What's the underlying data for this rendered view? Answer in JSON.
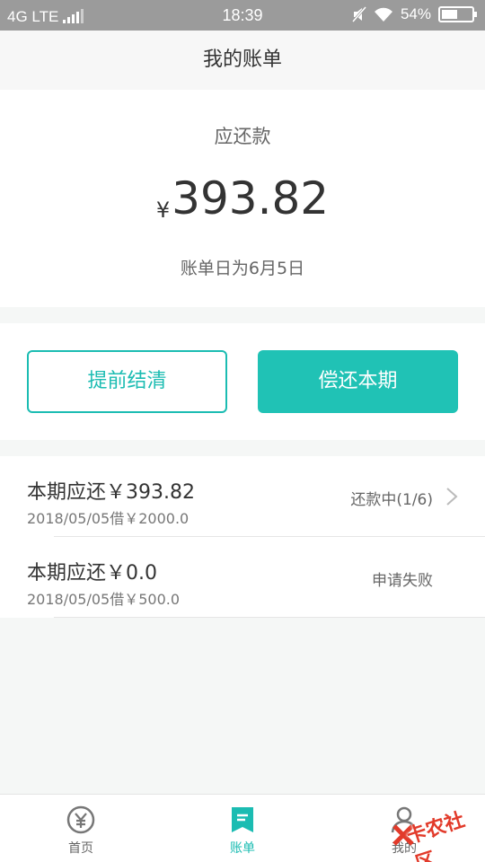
{
  "status_bar": {
    "network": "4G LTE",
    "time": "18:39",
    "battery": "54%",
    "battery_level": 0.54
  },
  "header": {
    "title": "我的账单"
  },
  "summary": {
    "label": "应还款",
    "currency": "¥",
    "amount": "393.82",
    "bill_day": "账单日为6月5日"
  },
  "actions": {
    "settle_early": "提前结清",
    "repay_current": "偿还本期"
  },
  "bills": [
    {
      "title": "本期应还￥393.82",
      "sub": "2018/05/05借￥2000.0",
      "status": "还款中(1/6)"
    },
    {
      "title": "本期应还￥0.0",
      "sub": "2018/05/05借￥500.0",
      "status": "申请失败"
    }
  ],
  "tabs": [
    {
      "label": "首页",
      "icon": "yen-circle-icon"
    },
    {
      "label": "账单",
      "icon": "bill-icon"
    },
    {
      "label": "我的",
      "icon": "person-icon"
    }
  ],
  "watermark": {
    "text": "卡农社区"
  },
  "colors": {
    "accent": "#20c2b5",
    "status_bar": "#9b9b9b"
  }
}
